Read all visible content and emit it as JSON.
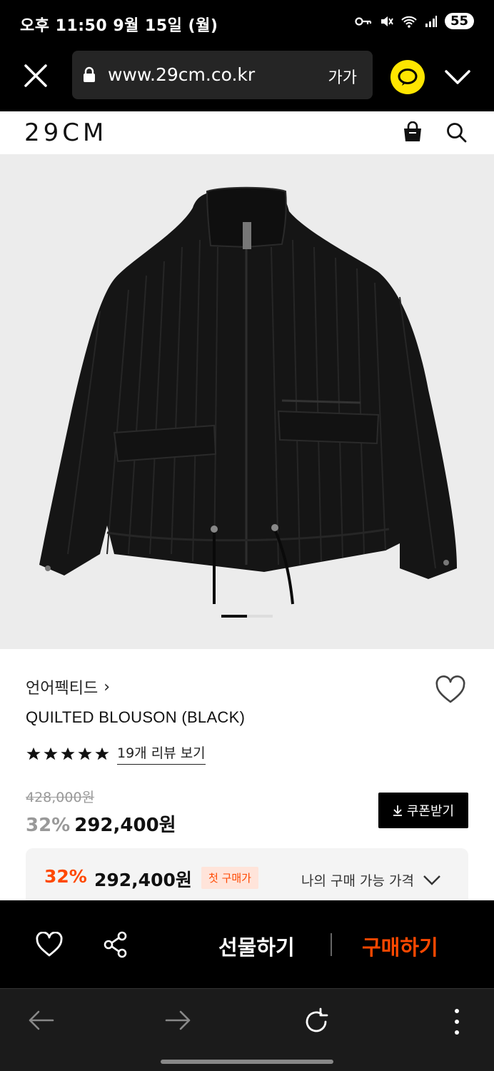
{
  "status_bar": {
    "time": "오후 11:50  9월 15일 (월)",
    "battery": "55",
    "icons": [
      "key-icon",
      "mute-icon",
      "wifi-icon",
      "signal-icon",
      "battery-icon"
    ]
  },
  "browser": {
    "url": "www.29cm.co.kr",
    "text_size_label": "가가",
    "icons": [
      "close-icon",
      "lock-icon",
      "kakaotalk-icon",
      "chevron-down-icon"
    ],
    "accent_color": "#fee500"
  },
  "header": {
    "logo": "29CM",
    "icons": [
      "shopping-bag-icon",
      "search-icon"
    ]
  },
  "product": {
    "image_description_icon": "black-quilted-jacket",
    "brand": "언어펙티드",
    "brand_chevron": "›",
    "name": "QUILTED BLOUSON (BLACK)",
    "rating_stars": 5,
    "review_link": "19개 리뷰 보기",
    "original_price": "428,000원",
    "discount_rate": "32%",
    "sale_price": "292,400원",
    "coupon_button": "쿠폰받기",
    "gallery_position": 1
  },
  "my_price": {
    "discount_rate": "32%",
    "price": "292,400원",
    "badge": "첫 구매가",
    "toggle_label": "나의 구매 가능 가격",
    "accent_color": "#ff4800"
  },
  "action_bar": {
    "gift_label": "선물하기",
    "buy_label": "구매하기",
    "icons": [
      "heart-icon",
      "share-icon"
    ]
  },
  "nav": {
    "icons": [
      "back-arrow-icon",
      "forward-arrow-icon",
      "refresh-icon",
      "more-vertical-icon"
    ]
  }
}
